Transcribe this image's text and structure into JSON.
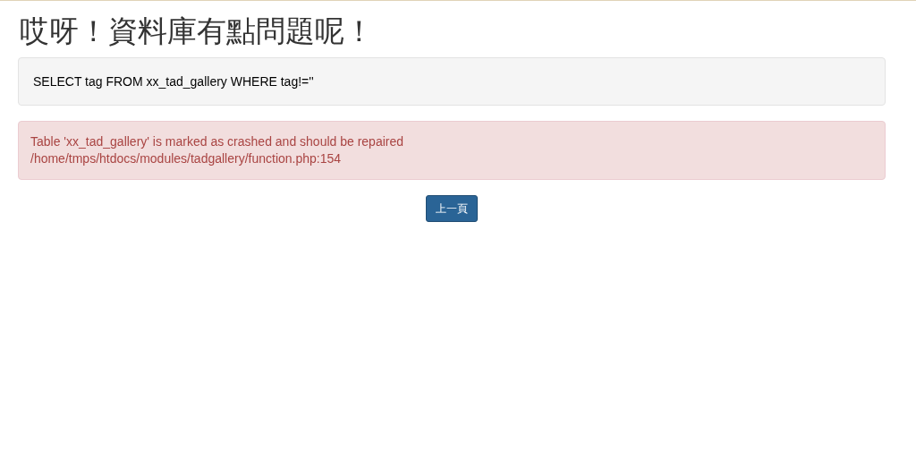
{
  "heading": "哎呀！資料庫有點問題呢！",
  "query": "SELECT tag FROM xx_tad_gallery WHERE tag!=''",
  "error_lines": [
    "Table 'xx_tad_gallery' is marked as crashed and should be repaired",
    "/home/tmps/htdocs/modules/tadgallery/function.php:154"
  ],
  "back_button": "上一頁"
}
